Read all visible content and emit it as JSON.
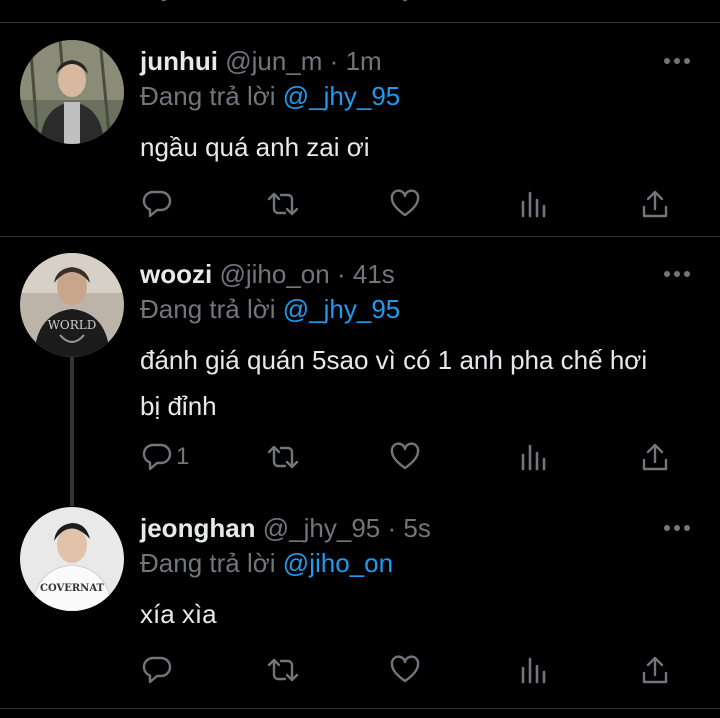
{
  "tweets": [
    {
      "name": "junhui",
      "handle": "@jun_m",
      "dot": "·",
      "time": "1m",
      "reply_prefix": "Đang trả lời",
      "reply_to": "@_jhy_95",
      "text": "ngầu quá anh zai ơi",
      "reply_count": ""
    },
    {
      "name": "woozi",
      "handle": "@jiho_on",
      "dot": "·",
      "time": "41s",
      "reply_prefix": "Đang trả lời",
      "reply_to": "@_jhy_95",
      "text": "đánh giá quán 5sao vì có 1 anh pha chế hơi bị đỉnh",
      "reply_count": "1"
    },
    {
      "name": "jeonghan",
      "handle": "@_jhy_95",
      "dot": "·",
      "time": "5s",
      "reply_prefix": "Đang trả lời",
      "reply_to": "@jiho_on",
      "text": "xía xìa",
      "reply_count": ""
    }
  ],
  "icons": {
    "reply": "reply-icon",
    "retweet": "retweet-icon",
    "like": "like-icon",
    "views": "views-icon",
    "share": "share-icon",
    "more": "more-icon"
  },
  "colors": {
    "background": "#000000",
    "text": "#e7e9ea",
    "secondary": "#71767b",
    "mention": "#1d9bf0",
    "divider": "#2f3336"
  }
}
